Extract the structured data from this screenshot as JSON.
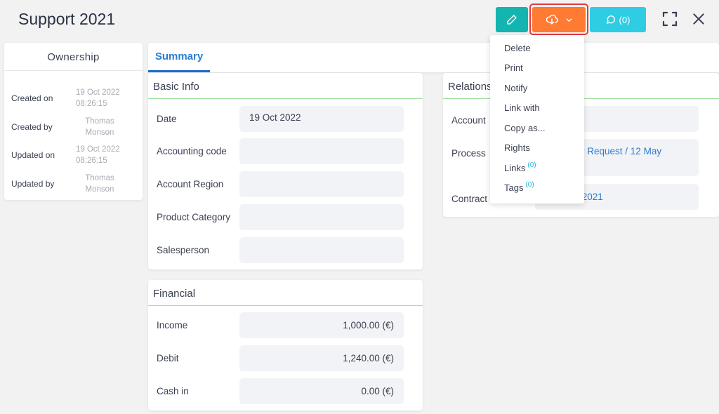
{
  "header": {
    "title": "Support 2021",
    "comment_count": "(0)"
  },
  "colors": {
    "edit": "#14b5b0",
    "download": "#ff7a33",
    "comment": "#2ecde3",
    "link": "#2a7bd1",
    "section_border": "#9fe09f"
  },
  "ownership": {
    "title": "Ownership",
    "rows": [
      {
        "label": "Created on",
        "value": "19 Oct 2022 08:26:15"
      },
      {
        "label": "Created by",
        "value": "Thomas Monson"
      },
      {
        "label": "Updated on",
        "value": "19 Oct 2022 08:26:15"
      },
      {
        "label": "Updated by",
        "value": "Thomas Monson"
      }
    ]
  },
  "tabs": [
    {
      "label": "Summary",
      "active": true
    }
  ],
  "basic_info": {
    "title": "Basic Info",
    "fields": [
      {
        "label": "Date",
        "value": "19 Oct 2022"
      },
      {
        "label": "Accounting code",
        "value": ""
      },
      {
        "label": "Account Region",
        "value": ""
      },
      {
        "label": "Product Category",
        "value": ""
      },
      {
        "label": "Salesperson",
        "value": ""
      }
    ]
  },
  "financial": {
    "title": "Financial",
    "fields": [
      {
        "label": "Income",
        "value": "1,000.00 (€)"
      },
      {
        "label": "Debit",
        "value": "1,240.00 (€)"
      },
      {
        "label": "Cash in",
        "value": "0.00 (€)"
      }
    ]
  },
  "relations": {
    "title": "Relations",
    "fields": [
      {
        "label": "Account",
        "value": ""
      },
      {
        "label": "Process",
        "value": "Customer Request / 12 May"
      },
      {
        "label": "Contract",
        "value": "Contract 2021"
      }
    ]
  },
  "menu": {
    "items": [
      {
        "label": "Delete"
      },
      {
        "label": "Print"
      },
      {
        "label": "Notify"
      },
      {
        "label": "Link with"
      },
      {
        "label": "Copy as..."
      },
      {
        "label": "Rights"
      },
      {
        "label": "Links",
        "badge": "(0)"
      },
      {
        "label": "Tags",
        "badge": "(0)"
      }
    ]
  }
}
